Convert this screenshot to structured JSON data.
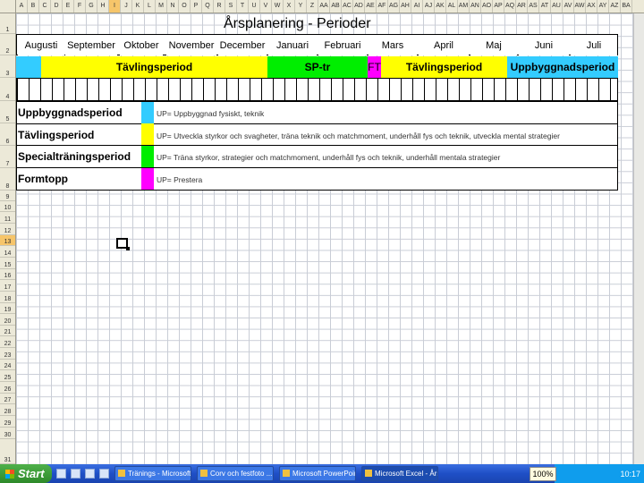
{
  "columns": [
    "A",
    "B",
    "C",
    "D",
    "E",
    "F",
    "G",
    "H",
    "I",
    "J",
    "K",
    "L",
    "M",
    "N",
    "O",
    "P",
    "Q",
    "R",
    "S",
    "T",
    "U",
    "V",
    "W",
    "X",
    "Y",
    "Z",
    "AA",
    "AB",
    "AC",
    "AD",
    "AE",
    "AF",
    "AG",
    "AH",
    "AI",
    "AJ",
    "AK",
    "AL",
    "AM",
    "AN",
    "AO",
    "AP",
    "AQ",
    "AR",
    "AS",
    "AT",
    "AU",
    "AV",
    "AW",
    "AX",
    "AY",
    "AZ",
    "BA"
  ],
  "selected_column": "I",
  "rows": [
    "1",
    "2",
    "3",
    "4",
    "5",
    "6",
    "7",
    "8",
    "9",
    "10",
    "11",
    "12",
    "13",
    "14",
    "15",
    "16",
    "17",
    "18",
    "19",
    "20",
    "21",
    "22",
    "23",
    "24",
    "25",
    "26",
    "27",
    "28",
    "29",
    "30",
    "31"
  ],
  "selected_row": "13",
  "sheet": {
    "title": "Årsplanering - Perioder",
    "months": [
      "Augusti",
      "September",
      "Oktober",
      "November",
      "December",
      "Januari",
      "Februari",
      "Mars",
      "April",
      "Maj",
      "Juni",
      "Juli"
    ],
    "periods": [
      {
        "label": "",
        "color": "#33ccff"
      },
      {
        "label": "Tävlingsperiod",
        "color": "#ffff00"
      },
      {
        "label": "SP-tr",
        "color": "#00ee00"
      },
      {
        "label": "FT",
        "color": "#ff00ff"
      },
      {
        "label": "Tävlingsperiod",
        "color": "#ffff00"
      },
      {
        "label": "Uppbyggnadsperiod",
        "color": "#33ccff"
      }
    ],
    "legend": [
      {
        "label": "Uppbyggnadsperiod",
        "color": "#33ccff",
        "desc": "UP= Uppbyggnad fysiskt, teknik"
      },
      {
        "label": "Tävlingsperiod",
        "color": "#ffff00",
        "desc": "UP= Utveckla styrkor och svagheter, träna teknik och matchmoment, underhåll fys och teknik, utveckla mental strategier"
      },
      {
        "label": "Specialträningsperiod",
        "color": "#00ee00",
        "desc": "UP= Träna styrkor, strategier och matchmoment, underhåll fys och teknik, underhåll mentala strategier"
      },
      {
        "label": "Formtopp",
        "color": "#ff00ff",
        "desc": "UP= Prestera"
      }
    ]
  },
  "taskbar": {
    "start_label": "Start",
    "tasks": [
      "Tränings - Microsoft ...",
      "Corv och festfoto ...",
      "Microsoft PowerPoint ...",
      "Microsoft Excel - Årsp..."
    ],
    "zoom": "100%",
    "clock": "10:17"
  }
}
